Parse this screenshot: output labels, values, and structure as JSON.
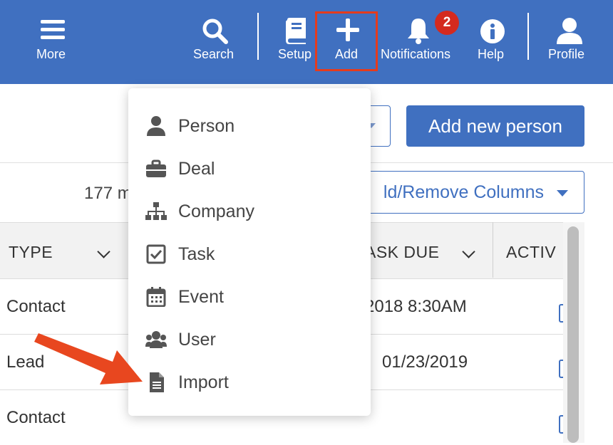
{
  "topbar": {
    "background": "#4070c0",
    "items": [
      {
        "label": "More",
        "icon": "menu-icon"
      },
      {
        "label": "Search",
        "icon": "search-icon"
      },
      {
        "label": "Setup",
        "icon": "book-icon"
      },
      {
        "label": "Add",
        "icon": "plus-icon"
      },
      {
        "label": "Notifications",
        "icon": "bell-icon"
      },
      {
        "label": "Help",
        "icon": "info-icon"
      },
      {
        "label": "Profile",
        "icon": "user-icon"
      }
    ],
    "notification_count": "2",
    "highlight_color": "#e53b1c"
  },
  "toolbar": {
    "add_new_person_label": "Add new person",
    "count_text": "177 m",
    "columns_label": "ld/Remove Columns"
  },
  "table": {
    "headers": [
      "TYPE",
      "ASK DUE",
      "ACTIV"
    ],
    "rows": [
      {
        "type": "Contact",
        "due": "2018 8:30AM"
      },
      {
        "type": "Lead",
        "due": "01/23/2019"
      },
      {
        "type": "Contact",
        "due": ""
      }
    ]
  },
  "add_menu": {
    "items": [
      {
        "label": "Person",
        "icon": "person-icon"
      },
      {
        "label": "Deal",
        "icon": "briefcase-icon"
      },
      {
        "label": "Company",
        "icon": "org-chart-icon"
      },
      {
        "label": "Task",
        "icon": "checkbox-icon"
      },
      {
        "label": "Event",
        "icon": "calendar-icon"
      },
      {
        "label": "User",
        "icon": "users-icon"
      },
      {
        "label": "Import",
        "icon": "document-icon"
      }
    ]
  },
  "annotation": {
    "arrow_color": "#e8471f"
  }
}
